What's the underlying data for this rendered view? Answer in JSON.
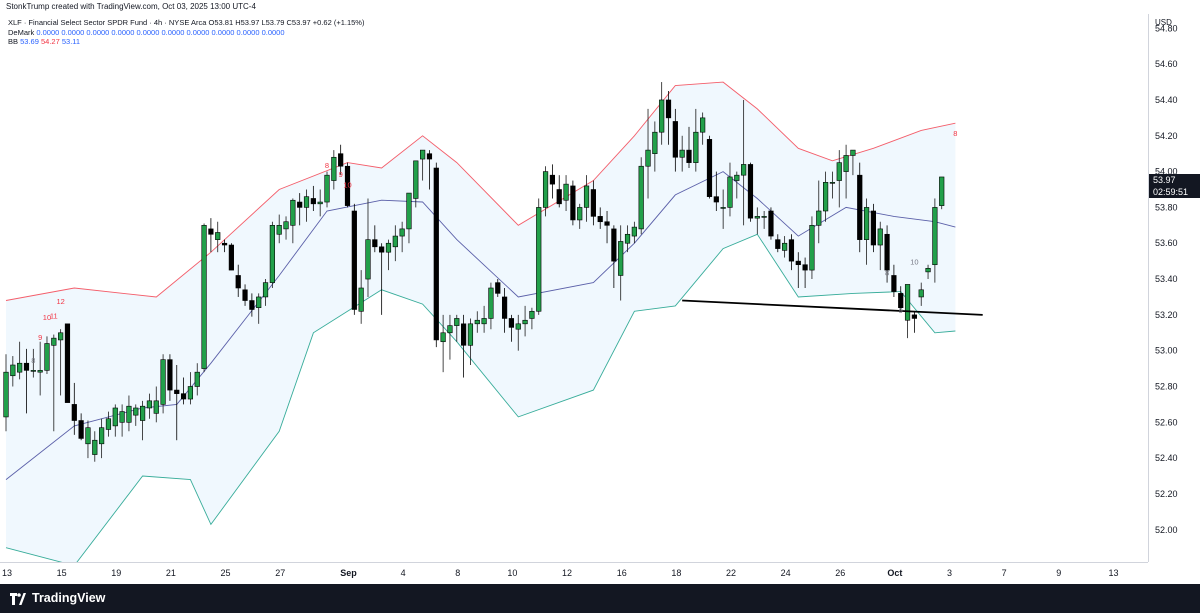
{
  "header": {
    "credit": "StonkTrump created with TradingView.com, Oct 03, 2025 13:00 UTC-4"
  },
  "legend": {
    "symbol_line": "XLF · Financial Select Sector SPDR Fund · 4h · NYSE Arca",
    "ohlc": "O53.81 H53.97 L53.79 C53.97 +0.62 (+1.15%)",
    "demark_label": "DeMark",
    "demark_values": "0.0000 0.0000 0.0000 0.0000 0.0000 0.0000 0.0000 0.0000 0.0000 0.0000",
    "bb_label": "BB",
    "bb_basis": "53.69",
    "bb_upper": "54.27",
    "bb_lower": "53.11"
  },
  "price_axis": {
    "currency": "USD",
    "last_price": "53.97",
    "countdown": "02:59:51"
  },
  "footer": {
    "brand": "TradingView"
  },
  "colors": {
    "up": "#26a69a",
    "up_fill": "#22a04a",
    "down": "#000000",
    "bb_upper": "#f23645",
    "bb_basis": "#2a2e8c",
    "bb_lower": "#089981",
    "bb_fill": "#e3f2fd",
    "demark_sell": "#f23645",
    "demark_buy": "#787b86"
  },
  "chart_data": {
    "type": "candlestick",
    "title": "XLF · Financial Select Sector SPDR Fund · 4h · NYSE Arca",
    "y_unit": "USD",
    "ylim": [
      51.82,
      54.88
    ],
    "y_ticks": [
      "54.80",
      "54.60",
      "54.40",
      "54.20",
      "54.00",
      "53.80",
      "53.60",
      "53.40",
      "53.20",
      "53.00",
      "52.80",
      "52.60",
      "52.40",
      "52.20",
      "52.00"
    ],
    "x_ticks": [
      "13",
      "15",
      "19",
      "21",
      "25",
      "27",
      "Sep",
      "4",
      "8",
      "10",
      "12",
      "16",
      "18",
      "22",
      "24",
      "26",
      "Oct",
      "3",
      "7",
      "9",
      "13"
    ],
    "candles": [
      {
        "o": 52.63,
        "h": 52.98,
        "l": 52.55,
        "c": 52.88
      },
      {
        "o": 52.86,
        "h": 52.97,
        "l": 52.8,
        "c": 52.92
      },
      {
        "o": 52.88,
        "h": 53.05,
        "l": 52.84,
        "c": 52.93
      },
      {
        "o": 52.93,
        "h": 53.01,
        "l": 52.65,
        "c": 52.89
      },
      {
        "o": 52.89,
        "h": 53.01,
        "l": 52.85,
        "c": 52.89
      },
      {
        "o": 52.88,
        "h": 53.05,
        "l": 52.75,
        "c": 52.89
      },
      {
        "o": 52.89,
        "h": 53.08,
        "l": 52.87,
        "c": 53.04
      },
      {
        "o": 53.03,
        "h": 53.09,
        "l": 52.55,
        "c": 53.07
      },
      {
        "o": 53.06,
        "h": 53.12,
        "l": 52.75,
        "c": 53.1
      },
      {
        "o": 53.15,
        "h": 53.15,
        "l": 52.72,
        "c": 52.71
      },
      {
        "o": 52.7,
        "h": 52.82,
        "l": 52.53,
        "c": 52.61
      },
      {
        "o": 52.61,
        "h": 52.65,
        "l": 52.5,
        "c": 52.51
      },
      {
        "o": 52.48,
        "h": 52.61,
        "l": 52.4,
        "c": 52.57
      },
      {
        "o": 52.42,
        "h": 52.55,
        "l": 52.38,
        "c": 52.5
      },
      {
        "o": 52.48,
        "h": 52.62,
        "l": 52.4,
        "c": 52.57
      },
      {
        "o": 52.56,
        "h": 52.66,
        "l": 52.52,
        "c": 52.62
      },
      {
        "o": 52.58,
        "h": 52.7,
        "l": 52.52,
        "c": 52.68
      },
      {
        "o": 52.6,
        "h": 52.7,
        "l": 52.52,
        "c": 52.66
      },
      {
        "o": 52.6,
        "h": 52.75,
        "l": 52.55,
        "c": 52.69
      },
      {
        "o": 52.64,
        "h": 52.7,
        "l": 52.58,
        "c": 52.68
      },
      {
        "o": 52.61,
        "h": 52.72,
        "l": 52.5,
        "c": 52.69
      },
      {
        "o": 52.68,
        "h": 52.76,
        "l": 52.62,
        "c": 52.72
      },
      {
        "o": 52.65,
        "h": 52.8,
        "l": 52.6,
        "c": 52.72
      },
      {
        "o": 52.7,
        "h": 52.98,
        "l": 52.65,
        "c": 52.95
      },
      {
        "o": 52.95,
        "h": 52.98,
        "l": 52.72,
        "c": 52.78
      },
      {
        "o": 52.78,
        "h": 52.92,
        "l": 52.5,
        "c": 52.76
      },
      {
        "o": 52.76,
        "h": 52.85,
        "l": 52.7,
        "c": 52.73
      },
      {
        "o": 52.73,
        "h": 52.88,
        "l": 52.7,
        "c": 52.8
      },
      {
        "o": 52.8,
        "h": 52.93,
        "l": 52.75,
        "c": 52.88
      },
      {
        "o": 52.9,
        "h": 53.71,
        "l": 52.88,
        "c": 53.7
      },
      {
        "o": 53.68,
        "h": 53.74,
        "l": 53.55,
        "c": 53.65
      },
      {
        "o": 53.62,
        "h": 53.72,
        "l": 53.55,
        "c": 53.66
      },
      {
        "o": 53.6,
        "h": 53.62,
        "l": 53.55,
        "c": 53.59
      },
      {
        "o": 53.59,
        "h": 53.6,
        "l": 53.45,
        "c": 53.45
      },
      {
        "o": 53.42,
        "h": 53.48,
        "l": 53.3,
        "c": 53.35
      },
      {
        "o": 53.34,
        "h": 53.37,
        "l": 53.25,
        "c": 53.28
      },
      {
        "o": 53.28,
        "h": 53.32,
        "l": 53.19,
        "c": 53.23
      },
      {
        "o": 53.24,
        "h": 53.32,
        "l": 53.15,
        "c": 53.3
      },
      {
        "o": 53.3,
        "h": 53.4,
        "l": 53.25,
        "c": 53.38
      },
      {
        "o": 53.38,
        "h": 53.72,
        "l": 53.35,
        "c": 53.7
      },
      {
        "o": 53.65,
        "h": 53.76,
        "l": 53.6,
        "c": 53.7
      },
      {
        "o": 53.68,
        "h": 53.75,
        "l": 53.62,
        "c": 53.72
      },
      {
        "o": 53.7,
        "h": 53.85,
        "l": 53.6,
        "c": 53.84
      },
      {
        "o": 53.83,
        "h": 53.88,
        "l": 53.7,
        "c": 53.8
      },
      {
        "o": 53.8,
        "h": 53.9,
        "l": 53.72,
        "c": 53.86
      },
      {
        "o": 53.85,
        "h": 53.92,
        "l": 53.78,
        "c": 53.82
      },
      {
        "o": 53.82,
        "h": 53.9,
        "l": 53.75,
        "c": 53.83
      },
      {
        "o": 53.83,
        "h": 54.0,
        "l": 53.8,
        "c": 53.98
      },
      {
        "o": 53.95,
        "h": 54.12,
        "l": 53.9,
        "c": 54.08
      },
      {
        "o": 54.1,
        "h": 54.15,
        "l": 53.98,
        "c": 54.03
      },
      {
        "o": 54.03,
        "h": 54.05,
        "l": 53.8,
        "c": 53.81
      },
      {
        "o": 53.78,
        "h": 53.82,
        "l": 53.2,
        "c": 53.23
      },
      {
        "o": 53.22,
        "h": 53.45,
        "l": 53.15,
        "c": 53.35
      },
      {
        "o": 53.4,
        "h": 53.85,
        "l": 53.3,
        "c": 53.62
      },
      {
        "o": 53.62,
        "h": 53.7,
        "l": 53.55,
        "c": 53.58
      },
      {
        "o": 53.58,
        "h": 53.6,
        "l": 53.2,
        "c": 53.55
      },
      {
        "o": 53.55,
        "h": 53.62,
        "l": 53.45,
        "c": 53.6
      },
      {
        "o": 53.58,
        "h": 53.7,
        "l": 53.5,
        "c": 53.64
      },
      {
        "o": 53.64,
        "h": 53.72,
        "l": 53.55,
        "c": 53.68
      },
      {
        "o": 53.68,
        "h": 53.85,
        "l": 53.6,
        "c": 53.88
      },
      {
        "o": 53.85,
        "h": 54.02,
        "l": 53.8,
        "c": 54.06
      },
      {
        "o": 54.07,
        "h": 54.12,
        "l": 53.95,
        "c": 54.12
      },
      {
        "o": 54.1,
        "h": 54.12,
        "l": 53.9,
        "c": 54.07
      },
      {
        "o": 54.02,
        "h": 54.05,
        "l": 53.02,
        "c": 53.06
      },
      {
        "o": 53.05,
        "h": 53.2,
        "l": 52.88,
        "c": 53.1
      },
      {
        "o": 53.1,
        "h": 53.2,
        "l": 52.95,
        "c": 53.14
      },
      {
        "o": 53.14,
        "h": 53.2,
        "l": 53.05,
        "c": 53.18
      },
      {
        "o": 53.15,
        "h": 53.2,
        "l": 52.85,
        "c": 53.03
      },
      {
        "o": 53.03,
        "h": 53.18,
        "l": 52.92,
        "c": 53.15
      },
      {
        "o": 53.15,
        "h": 53.22,
        "l": 53.1,
        "c": 53.17
      },
      {
        "o": 53.15,
        "h": 53.25,
        "l": 53.1,
        "c": 53.18
      },
      {
        "o": 53.18,
        "h": 53.38,
        "l": 53.12,
        "c": 53.35
      },
      {
        "o": 53.38,
        "h": 53.4,
        "l": 53.3,
        "c": 53.32
      },
      {
        "o": 53.3,
        "h": 53.35,
        "l": 53.1,
        "c": 53.18
      },
      {
        "o": 53.18,
        "h": 53.2,
        "l": 53.05,
        "c": 53.13
      },
      {
        "o": 53.12,
        "h": 53.2,
        "l": 53.0,
        "c": 53.15
      },
      {
        "o": 53.15,
        "h": 53.25,
        "l": 53.08,
        "c": 53.17
      },
      {
        "o": 53.18,
        "h": 53.24,
        "l": 53.12,
        "c": 53.22
      },
      {
        "o": 53.22,
        "h": 53.85,
        "l": 53.2,
        "c": 53.8
      },
      {
        "o": 53.8,
        "h": 54.03,
        "l": 53.75,
        "c": 54.0
      },
      {
        "o": 53.98,
        "h": 54.04,
        "l": 53.85,
        "c": 53.93
      },
      {
        "o": 53.9,
        "h": 53.98,
        "l": 53.8,
        "c": 53.82
      },
      {
        "o": 53.84,
        "h": 53.98,
        "l": 53.78,
        "c": 53.93
      },
      {
        "o": 53.92,
        "h": 53.95,
        "l": 53.7,
        "c": 53.73
      },
      {
        "o": 53.73,
        "h": 53.82,
        "l": 53.68,
        "c": 53.8
      },
      {
        "o": 53.8,
        "h": 53.98,
        "l": 53.72,
        "c": 53.92
      },
      {
        "o": 53.9,
        "h": 53.95,
        "l": 53.7,
        "c": 53.75
      },
      {
        "o": 53.75,
        "h": 53.8,
        "l": 53.68,
        "c": 53.72
      },
      {
        "o": 53.72,
        "h": 53.78,
        "l": 53.6,
        "c": 53.7
      },
      {
        "o": 53.68,
        "h": 53.7,
        "l": 53.35,
        "c": 53.5
      },
      {
        "o": 53.42,
        "h": 53.7,
        "l": 53.28,
        "c": 53.61
      },
      {
        "o": 53.6,
        "h": 53.7,
        "l": 53.55,
        "c": 53.65
      },
      {
        "o": 53.64,
        "h": 53.72,
        "l": 53.6,
        "c": 53.69
      },
      {
        "o": 53.68,
        "h": 54.08,
        "l": 53.65,
        "c": 54.03
      },
      {
        "o": 54.03,
        "h": 54.35,
        "l": 53.85,
        "c": 54.12
      },
      {
        "o": 54.1,
        "h": 54.28,
        "l": 54.0,
        "c": 54.22
      },
      {
        "o": 54.22,
        "h": 54.5,
        "l": 54.15,
        "c": 54.4
      },
      {
        "o": 54.4,
        "h": 54.45,
        "l": 54.15,
        "c": 54.3
      },
      {
        "o": 54.28,
        "h": 54.35,
        "l": 54.0,
        "c": 54.08
      },
      {
        "o": 54.08,
        "h": 54.2,
        "l": 54.0,
        "c": 54.12
      },
      {
        "o": 54.12,
        "h": 54.25,
        "l": 54.02,
        "c": 54.05
      },
      {
        "o": 54.05,
        "h": 54.35,
        "l": 54.0,
        "c": 54.22
      },
      {
        "o": 54.22,
        "h": 54.33,
        "l": 54.15,
        "c": 54.3
      },
      {
        "o": 54.18,
        "h": 54.2,
        "l": 53.85,
        "c": 53.86
      },
      {
        "o": 53.86,
        "h": 54.0,
        "l": 53.78,
        "c": 53.83
      },
      {
        "o": 53.8,
        "h": 53.9,
        "l": 53.68,
        "c": 53.8
      },
      {
        "o": 53.8,
        "h": 54.05,
        "l": 53.75,
        "c": 53.97
      },
      {
        "o": 53.95,
        "h": 54.0,
        "l": 53.85,
        "c": 53.98
      },
      {
        "o": 53.98,
        "h": 54.4,
        "l": 53.7,
        "c": 54.04
      },
      {
        "o": 54.04,
        "h": 54.05,
        "l": 53.72,
        "c": 53.74
      },
      {
        "o": 53.74,
        "h": 53.8,
        "l": 53.65,
        "c": 53.75
      },
      {
        "o": 53.75,
        "h": 53.78,
        "l": 53.68,
        "c": 53.75
      },
      {
        "o": 53.78,
        "h": 53.8,
        "l": 53.62,
        "c": 53.64
      },
      {
        "o": 53.62,
        "h": 53.65,
        "l": 53.55,
        "c": 53.57
      },
      {
        "o": 53.56,
        "h": 53.64,
        "l": 53.52,
        "c": 53.6
      },
      {
        "o": 53.62,
        "h": 53.65,
        "l": 53.45,
        "c": 53.5
      },
      {
        "o": 53.5,
        "h": 53.55,
        "l": 53.35,
        "c": 53.48
      },
      {
        "o": 53.48,
        "h": 53.52,
        "l": 53.35,
        "c": 53.45
      },
      {
        "o": 53.45,
        "h": 53.75,
        "l": 53.4,
        "c": 53.7
      },
      {
        "o": 53.7,
        "h": 53.95,
        "l": 53.6,
        "c": 53.78
      },
      {
        "o": 53.78,
        "h": 54.0,
        "l": 53.72,
        "c": 53.94
      },
      {
        "o": 53.94,
        "h": 54.0,
        "l": 53.85,
        "c": 53.94
      },
      {
        "o": 53.95,
        "h": 54.12,
        "l": 53.8,
        "c": 54.05
      },
      {
        "o": 54.0,
        "h": 54.15,
        "l": 53.85,
        "c": 54.09
      },
      {
        "o": 54.09,
        "h": 54.12,
        "l": 53.98,
        "c": 54.12
      },
      {
        "o": 53.98,
        "h": 54.05,
        "l": 53.55,
        "c": 53.62
      },
      {
        "o": 53.62,
        "h": 53.85,
        "l": 53.48,
        "c": 53.8
      },
      {
        "o": 53.78,
        "h": 53.82,
        "l": 53.55,
        "c": 53.59
      },
      {
        "o": 53.59,
        "h": 53.72,
        "l": 53.45,
        "c": 53.68
      },
      {
        "o": 53.65,
        "h": 53.7,
        "l": 53.38,
        "c": 53.45
      },
      {
        "o": 53.42,
        "h": 53.48,
        "l": 53.3,
        "c": 53.33
      },
      {
        "o": 53.32,
        "h": 53.36,
        "l": 53.22,
        "c": 53.24
      },
      {
        "o": 53.17,
        "h": 53.35,
        "l": 53.07,
        "c": 53.37
      },
      {
        "o": 53.2,
        "h": 53.22,
        "l": 53.1,
        "c": 53.18
      },
      {
        "o": 53.3,
        "h": 53.38,
        "l": 53.25,
        "c": 53.34
      },
      {
        "o": 53.44,
        "h": 53.48,
        "l": 53.4,
        "c": 53.46
      },
      {
        "o": 53.48,
        "h": 53.85,
        "l": 53.38,
        "c": 53.8
      },
      {
        "o": 53.81,
        "h": 53.97,
        "l": 53.79,
        "c": 53.97
      }
    ],
    "bb_upper_points": [
      [
        0,
        53.28
      ],
      [
        10,
        53.35
      ],
      [
        22,
        53.3
      ],
      [
        30,
        53.55
      ],
      [
        40,
        53.9
      ],
      [
        50,
        54.05
      ],
      [
        55,
        54.02
      ],
      [
        61,
        54.2
      ],
      [
        66,
        54.05
      ],
      [
        75,
        53.7
      ],
      [
        86,
        53.95
      ],
      [
        92,
        54.2
      ],
      [
        98,
        54.48
      ],
      [
        105,
        54.5
      ],
      [
        110,
        54.35
      ],
      [
        116,
        54.13
      ],
      [
        121,
        54.06
      ],
      [
        127,
        54.13
      ],
      [
        134,
        54.23
      ],
      [
        139,
        54.27
      ]
    ],
    "bb_basis_points": [
      [
        0,
        52.28
      ],
      [
        10,
        52.58
      ],
      [
        20,
        52.68
      ],
      [
        25,
        52.7
      ],
      [
        30,
        52.93
      ],
      [
        40,
        53.42
      ],
      [
        47,
        53.78
      ],
      [
        55,
        53.84
      ],
      [
        61,
        53.83
      ],
      [
        66,
        53.62
      ],
      [
        75,
        53.3
      ],
      [
        86,
        53.38
      ],
      [
        92,
        53.6
      ],
      [
        98,
        53.87
      ],
      [
        105,
        54.0
      ],
      [
        110,
        53.85
      ],
      [
        116,
        53.64
      ],
      [
        123,
        53.8
      ],
      [
        130,
        53.75
      ],
      [
        136,
        53.72
      ],
      [
        139,
        53.69
      ]
    ],
    "bb_lower_points": [
      [
        0,
        51.9
      ],
      [
        10,
        51.8
      ],
      [
        20,
        52.3
      ],
      [
        27,
        52.28
      ],
      [
        30,
        52.03
      ],
      [
        40,
        52.55
      ],
      [
        45,
        53.1
      ],
      [
        55,
        53.34
      ],
      [
        61,
        53.26
      ],
      [
        66,
        53.05
      ],
      [
        75,
        52.63
      ],
      [
        86,
        52.78
      ],
      [
        92,
        53.22
      ],
      [
        98,
        53.25
      ],
      [
        105,
        53.57
      ],
      [
        110,
        53.65
      ],
      [
        116,
        53.3
      ],
      [
        124,
        53.32
      ],
      [
        131,
        53.33
      ],
      [
        136,
        53.1
      ],
      [
        139,
        53.11
      ]
    ],
    "trendline": {
      "from": [
        99,
        53.28
      ],
      "to": [
        143,
        53.2
      ]
    },
    "demark_labels": [
      {
        "i": 4,
        "v": 52.93,
        "label": "8",
        "side": "buy"
      },
      {
        "i": 5,
        "v": 53.06,
        "label": "9",
        "side": "sell"
      },
      {
        "i": 6,
        "v": 53.17,
        "label": "10",
        "side": "sell"
      },
      {
        "i": 7,
        "v": 53.18,
        "label": "11",
        "side": "sell"
      },
      {
        "i": 8,
        "v": 53.26,
        "label": "12",
        "side": "sell"
      },
      {
        "i": 47,
        "v": 54.02,
        "label": "8",
        "side": "sell"
      },
      {
        "i": 49,
        "v": 53.97,
        "label": "9",
        "side": "sell"
      },
      {
        "i": 50,
        "v": 53.91,
        "label": "10",
        "side": "sell"
      },
      {
        "i": 129,
        "v": 53.42,
        "label": "8",
        "side": "buy"
      },
      {
        "i": 131,
        "v": 53.21,
        "label": "9",
        "side": "buy"
      },
      {
        "i": 133,
        "v": 53.48,
        "label": "10",
        "side": "buy"
      },
      {
        "i": 139,
        "v": 54.2,
        "label": "8",
        "side": "sell"
      }
    ]
  }
}
